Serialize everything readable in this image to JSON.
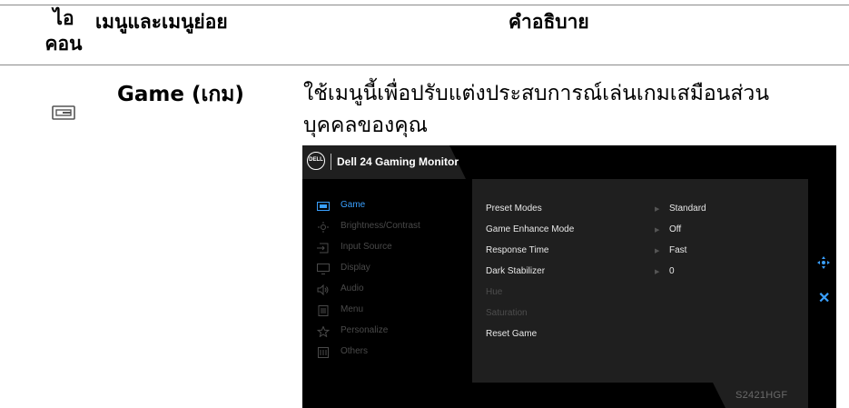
{
  "table": {
    "header_icon": "ไอ\nคอน",
    "header_icon_line1": "ไอ",
    "header_icon_line2": "คอน",
    "header_menu": "เมนูและเมนูย่อย",
    "header_desc": "คำอธิบาย"
  },
  "row": {
    "icon": "game-icon",
    "menu_name": "Game (เกม)",
    "description_line1": "ใช้เมนูนี้เพื่อปรับแต่งประสบการณ์เล่นเกมเสมือนส่วน",
    "description_line2": "บุคคลของคุณ"
  },
  "osd": {
    "logo_text": "DELL",
    "title": "Dell 24 Gaming Monitor",
    "model": "S2421HGF",
    "menu": [
      {
        "label": "Game",
        "icon": "game-icon",
        "active": true
      },
      {
        "label": "Brightness/Contrast",
        "icon": "brightness-icon",
        "active": false
      },
      {
        "label": "Input Source",
        "icon": "input-source-icon",
        "active": false
      },
      {
        "label": "Display",
        "icon": "display-icon",
        "active": false
      },
      {
        "label": "Audio",
        "icon": "audio-icon",
        "active": false
      },
      {
        "label": "Menu",
        "icon": "menu-icon",
        "active": false
      },
      {
        "label": "Personalize",
        "icon": "star-icon",
        "active": false
      },
      {
        "label": "Others",
        "icon": "others-icon",
        "active": false
      }
    ],
    "options": [
      {
        "label": "Preset Modes",
        "value": "Standard"
      },
      {
        "label": "Game Enhance Mode",
        "value": "Off"
      },
      {
        "label": "Response Time",
        "value": "Fast"
      },
      {
        "label": "Dark Stabilizer",
        "value": "0"
      },
      {
        "label": "Hue",
        "value": ""
      },
      {
        "label": "Saturation",
        "value": ""
      },
      {
        "label": "Reset Game",
        "value": ""
      }
    ],
    "nav_icons": [
      "move-icon",
      "close-icon"
    ],
    "colors": {
      "accent": "#3aa0ff",
      "panel": "#1f1f1f",
      "frame": "#000000"
    }
  }
}
